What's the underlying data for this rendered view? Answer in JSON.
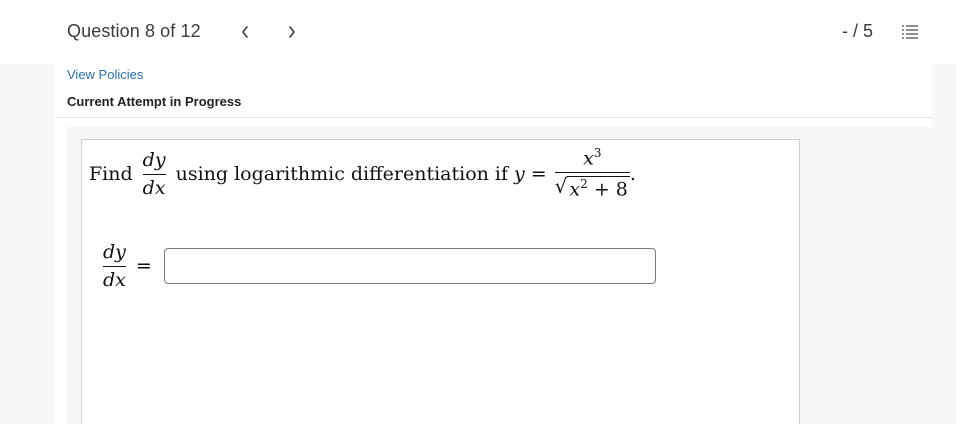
{
  "header": {
    "question_label": "Question 8 of 12",
    "prev_glyph": "<",
    "next_glyph": ">",
    "score": "- / 5",
    "icons": {
      "prev": "chevron-left-icon",
      "next": "chevron-right-icon",
      "list": "question-list-icon"
    }
  },
  "links": {
    "view_policies": "View Policies"
  },
  "status": {
    "attempt": "Current Attempt in Progress"
  },
  "question": {
    "find": "Find",
    "deriv_num": "dy",
    "deriv_den": "dx",
    "text": "using logarithmic differentiation if",
    "y_var": "y",
    "equals": "=",
    "numerator_base": "x",
    "numerator_exp": "3",
    "denominator_base": "x",
    "denominator_exp": "2",
    "denominator_rest": "+ 8",
    "period": "."
  },
  "answer": {
    "lhs_num": "dy",
    "lhs_den": "dx",
    "equals": "=",
    "value": ""
  }
}
